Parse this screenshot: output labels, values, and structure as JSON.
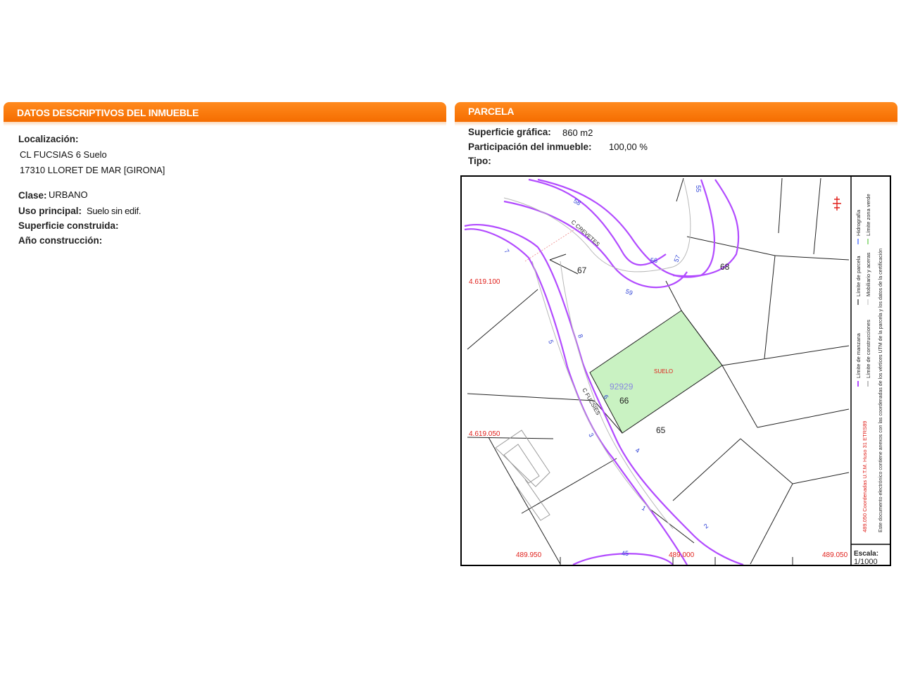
{
  "left_panel": {
    "title": "DATOS DESCRIPTIVOS DEL INMUEBLE",
    "localizacion_label": "Localización:",
    "address_line1": "CL FUCSIAS 6 Suelo",
    "address_line2": "17310 LLORET DE MAR [GIRONA]",
    "clase_label": "Clase:",
    "clase_value": "URBANO",
    "uso_label": "Uso principal:",
    "uso_value": "Suelo sin edif.",
    "superficie_construida_label": "Superficie construida:",
    "anio_label": "Año construcción:"
  },
  "right_panel": {
    "title": "PARCELA",
    "superficie_label": "Superficie gráfica:",
    "superficie_value": "860 m2",
    "participacion_label": "Participación del inmueble:",
    "participacion_value": "100,00 %",
    "tipo_label": "Tipo:"
  },
  "map": {
    "street_names": [
      "C CREVETES",
      "C FUCSIES"
    ],
    "parcel_numbers": [
      "67",
      "68",
      "66",
      "65"
    ],
    "selected_parcel_ref": "92929",
    "selected_parcel_label": "SUELO",
    "house_numbers": [
      "55",
      "56",
      "57",
      "58",
      "59",
      "7",
      "5",
      "8",
      "6",
      "3",
      "4",
      "1",
      "2",
      "45"
    ],
    "coord_y_labels": [
      "4.619.100",
      "4.619.050"
    ],
    "coord_x_labels": [
      "489.950",
      "489.000",
      "489.050"
    ],
    "legend": {
      "col1_a": "Límite de manzana",
      "col1_b": "Límite de parcela",
      "col1_c": "Hidrografía",
      "col2_a": "Límite de construcciones",
      "col2_b": "Mobiliario y aceras",
      "col2_c": "Límite zona verde",
      "coords_note": "489.050 Coordenadas U.T.M. Huso 31 ETRS89",
      "document_note": "Este documento electrónico contiene anexos con las coordenadas de los vértices UTM de la parcela y los datos de la certificación"
    },
    "scale_label": "Escala:",
    "scale_value": "1/1000",
    "colors": {
      "block_boundary": "#b24bff",
      "selected_fill": "#c9f2c2",
      "coord_text": "#e0201b",
      "house_number": "#2b3fd6"
    }
  }
}
